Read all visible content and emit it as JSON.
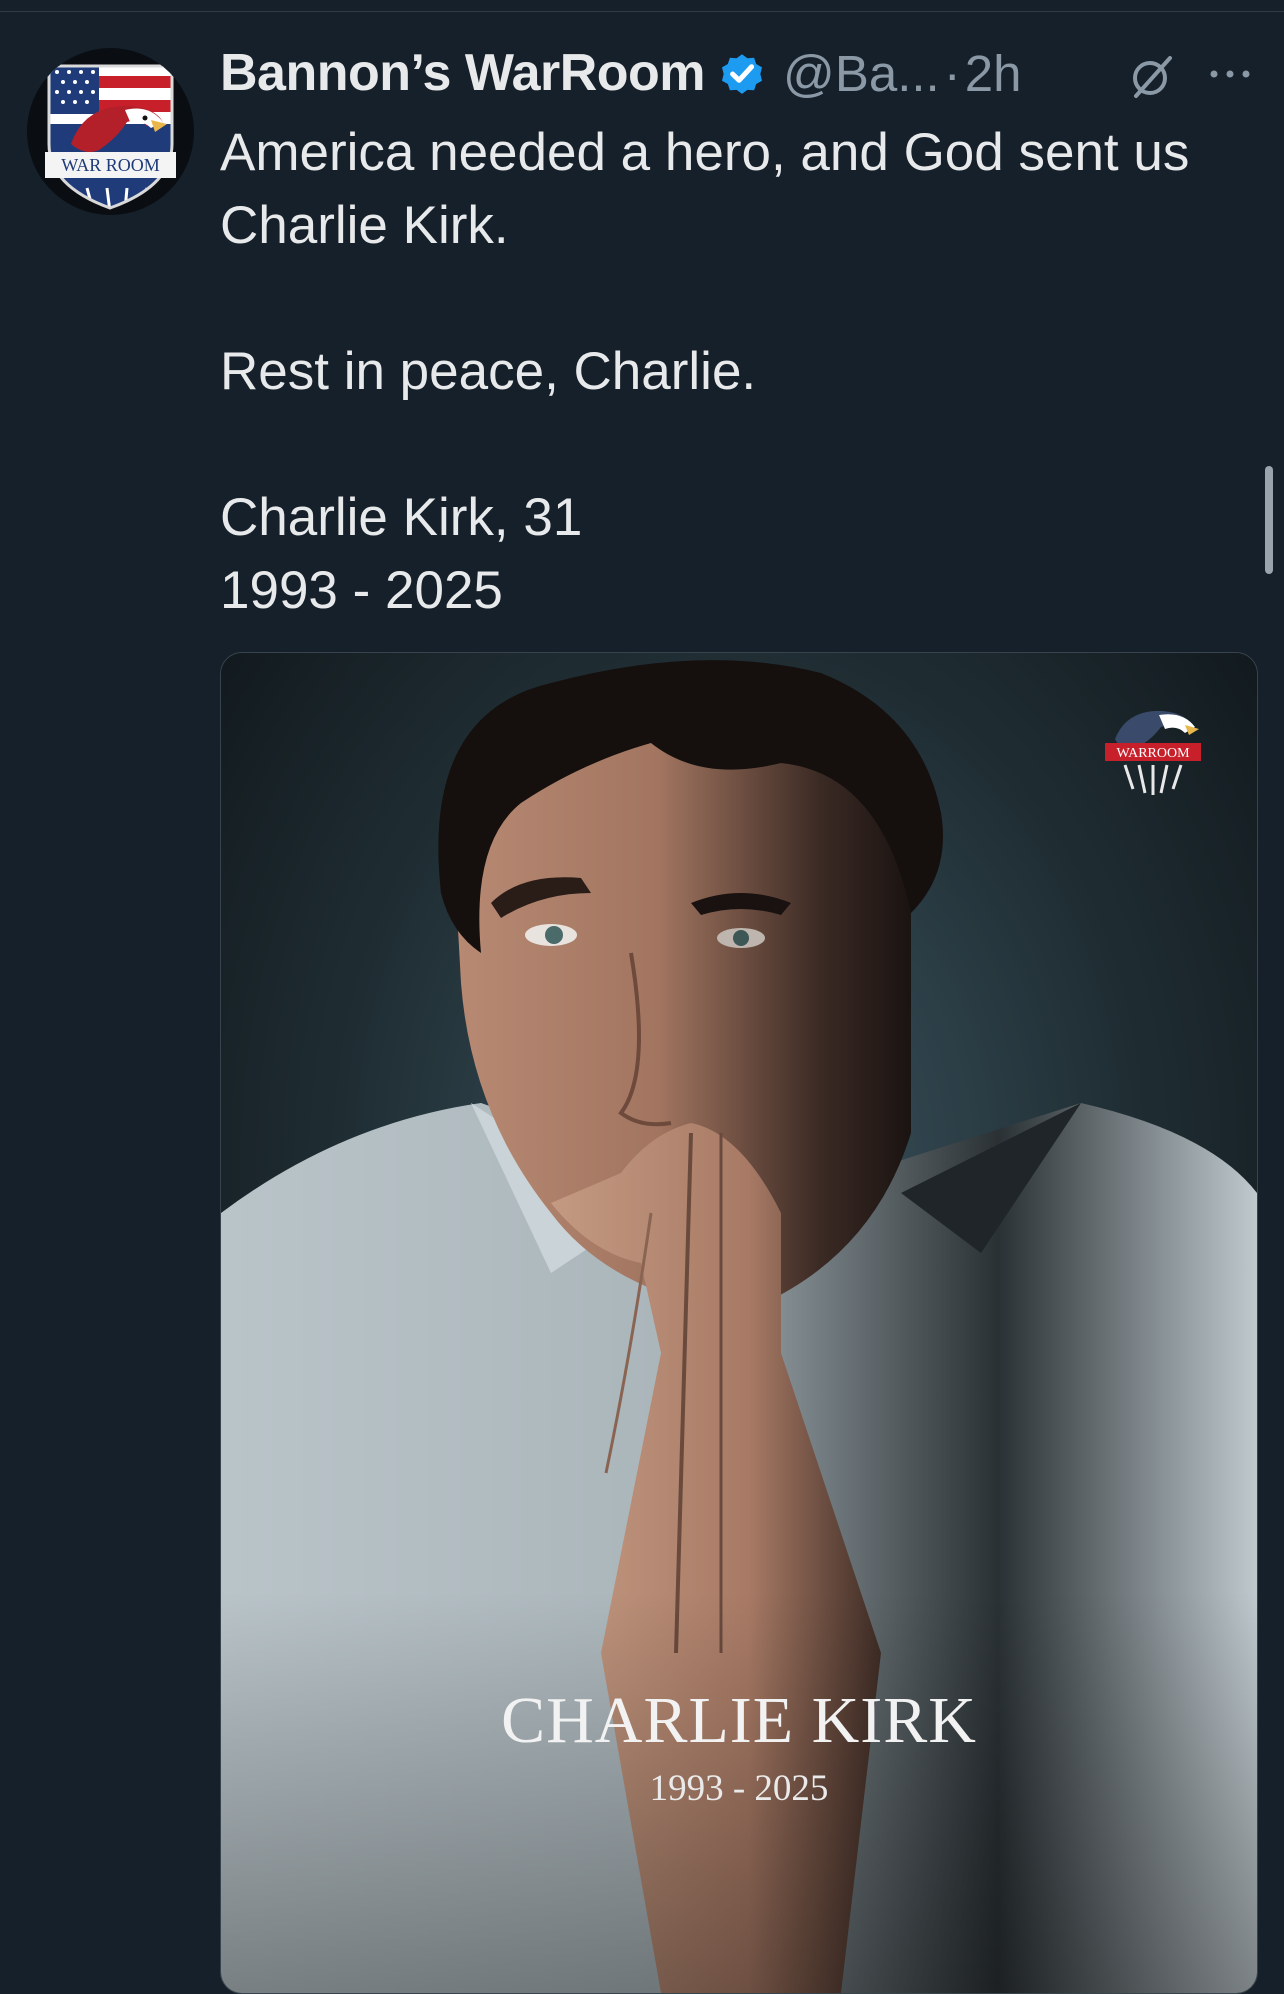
{
  "post": {
    "display_name": "Bannon’s WarRoom",
    "handle": "@Ba...",
    "separator": "·",
    "time": "2h",
    "avatar_text": "WAR ROOM",
    "text": {
      "line1": "America needed a hero, and God sent us Charlie Kirk.",
      "line2": "Rest in peace, Charlie.",
      "line3": "Charlie Kirk, 31",
      "line4": "1993 - 2025"
    }
  },
  "media": {
    "title": "CHARLIE KIRK",
    "years": "1993 - 2025",
    "logo_text": "WARROOM"
  },
  "icons": {
    "verified": "verified-badge-icon",
    "grok": "grok-icon",
    "more": "more-icon"
  },
  "colors": {
    "background": "#15202b",
    "text_primary": "#e7e9ea",
    "text_secondary": "#8b98a5",
    "verified": "#1d9bf0",
    "brand_red": "#c8202b"
  }
}
